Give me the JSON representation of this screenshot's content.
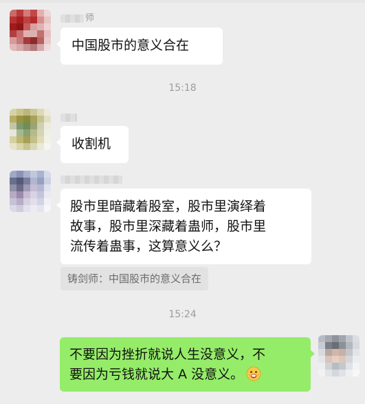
{
  "messages": {
    "m1": {
      "sender_visible": "师",
      "text": "中国股市的意义合在"
    },
    "time1": "15:18",
    "m2": {
      "sender_visible": "",
      "text": "收割机"
    },
    "m3": {
      "line1": "股市里暗藏着股室，股市里演绎着",
      "line2": "故事，股市里深藏着蛊师，股市里",
      "line3": "流传着蛊事，这算意义么？"
    },
    "quote": "铸剑师：中国股市的意义合在",
    "time2": "15:24",
    "m4": {
      "line1": "不要因为挫折就说人生没意义，不",
      "line2": "要因为亏钱就说大 A 没意义。"
    }
  },
  "icons": {
    "reply_emoji": "grimace-emoji-icon"
  },
  "colors": {
    "background": "#ededed",
    "bubble_incoming": "#ffffff",
    "bubble_outgoing": "#95ec69",
    "timestamp": "#9c9c9c",
    "quote_bg": "#e2e2e2"
  }
}
